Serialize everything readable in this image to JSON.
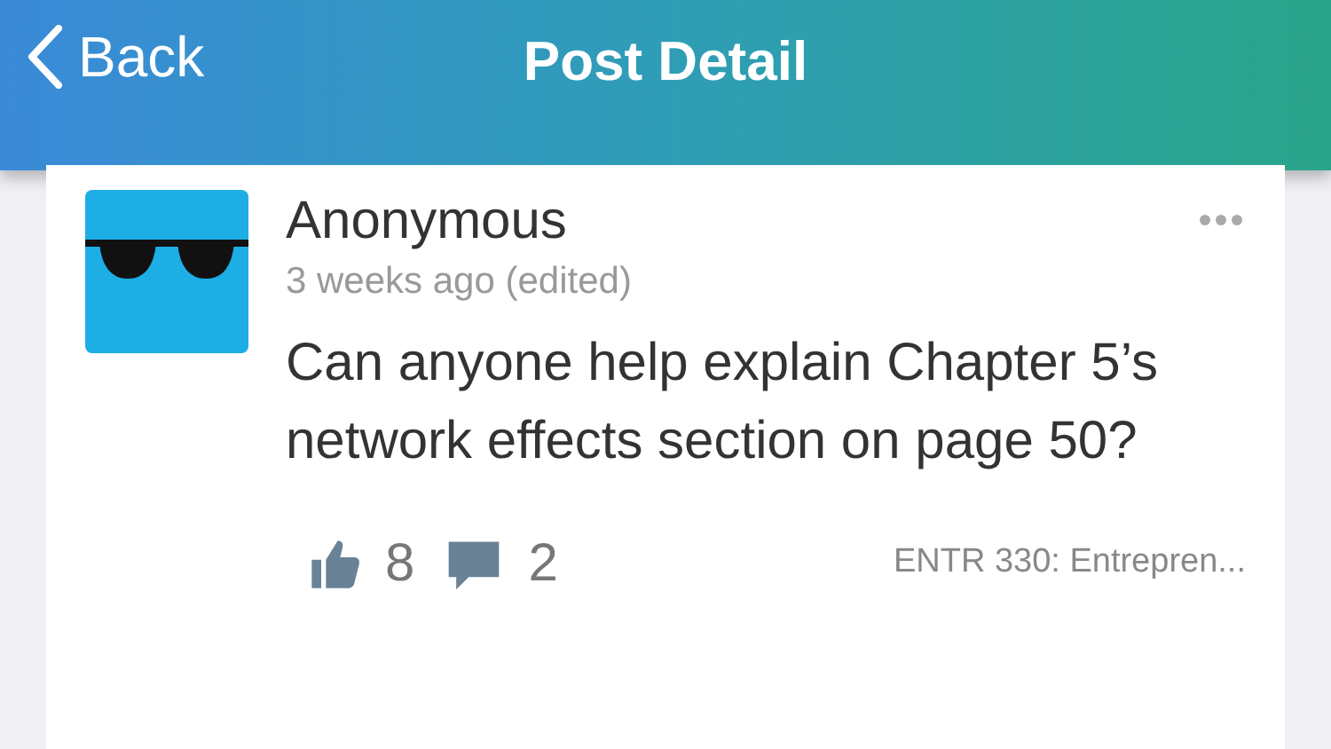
{
  "header": {
    "back_label": "Back",
    "title": "Post Detail"
  },
  "post": {
    "author": "Anonymous",
    "time": "3 weeks ago (edited)",
    "body": "Can anyone help explain Chapter 5’s network effects section on page 50?",
    "likes": "8",
    "comments": "2",
    "course": "ENTR 330: Entrepren..."
  }
}
